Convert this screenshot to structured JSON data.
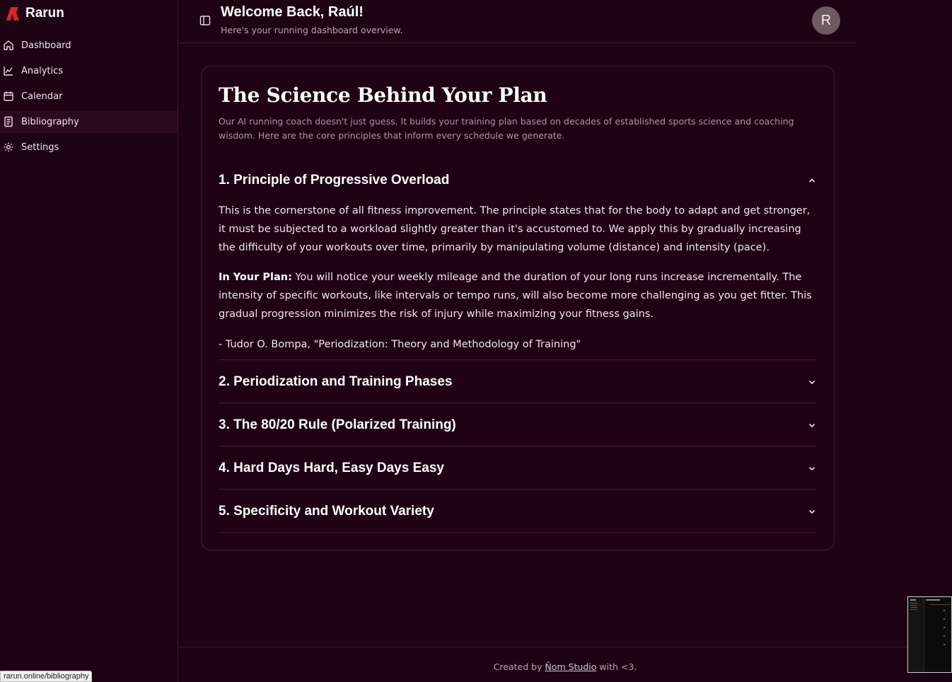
{
  "brand": {
    "name": "Rarun",
    "accent": "#d8232a"
  },
  "sidebar": {
    "items": [
      {
        "label": "Dashboard",
        "icon": "home-icon"
      },
      {
        "label": "Analytics",
        "icon": "chart-line-icon"
      },
      {
        "label": "Calendar",
        "icon": "calendar-icon"
      },
      {
        "label": "Bibliography",
        "icon": "document-icon",
        "active": true
      },
      {
        "label": "Settings",
        "icon": "gear-icon"
      }
    ]
  },
  "header": {
    "title": "Welcome Back, Raúl!",
    "subtitle": "Here's your running dashboard overview.",
    "avatar_initial": "R"
  },
  "card": {
    "title": "The Science Behind Your Plan",
    "intro": "Our AI running coach doesn't just guess. It builds your training plan based on decades of established sports science and coaching wisdom. Here are the core principles that inform every schedule we generate.",
    "sections": [
      {
        "title": "1. Principle of Progressive Overload",
        "expanded": true,
        "body": "This is the cornerstone of all fitness improvement. The principle states that for the body to adapt and get stronger, it must be subjected to a workload slightly greater than it's accustomed to. We apply this by gradually increasing the difficulty of your workouts over time, primarily by manipulating volume (distance) and intensity (pace).",
        "plan_label": "In Your Plan:",
        "plan_text": " You will notice your weekly mileage and the duration of your long runs increase incrementally. The intensity of specific workouts, like intervals or tempo runs, will also become more challenging as you get fitter. This gradual progression minimizes the risk of injury while maximizing your fitness gains.",
        "citation": "- Tudor O. Bompa, \"Periodization: Theory and Methodology of Training\""
      },
      {
        "title": "2. Periodization and Training Phases",
        "expanded": false
      },
      {
        "title": "3. The 80/20 Rule (Polarized Training)",
        "expanded": false
      },
      {
        "title": "4. Hard Days Hard, Easy Days Easy",
        "expanded": false
      },
      {
        "title": "5. Specificity and Workout Variety",
        "expanded": false
      }
    ]
  },
  "footer": {
    "prefix": "Created by ",
    "link": "Ñom Studio",
    "suffix": " with <3."
  },
  "status_bar": {
    "url": "rarun.online/bibliography"
  }
}
